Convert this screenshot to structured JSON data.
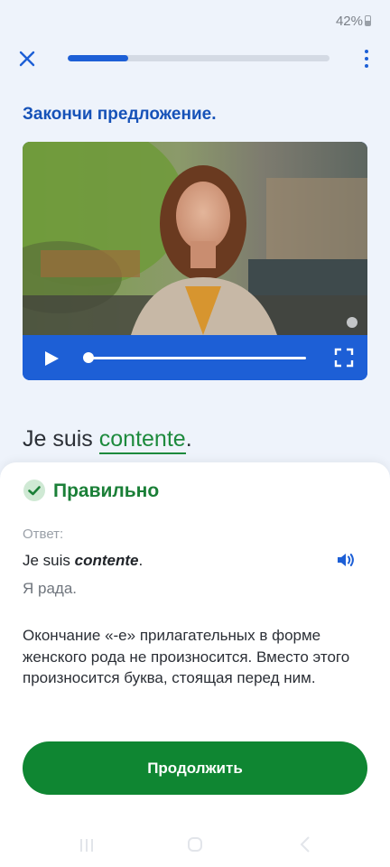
{
  "status": {
    "battery": "42%"
  },
  "lesson": {
    "progress": 0.23
  },
  "instruction": "Закончи предложение.",
  "video": {
    "playback_position": 0.0
  },
  "sentence": {
    "before": "Je suis ",
    "answer": "contente",
    "after": "."
  },
  "feedback": {
    "title": "Правильно",
    "answer_label": "Ответ:",
    "answer_prefix": "Je suis ",
    "answer_word": "contente",
    "answer_suffix": ".",
    "translation": "Я рада.",
    "explanation": "Окончание «-е» прилагательных в форме женского рода не произносится. Вместо этого произносится буква, стоящая перед ним."
  },
  "continue_label": "Продолжить",
  "colors": {
    "accent": "#1d5fd6",
    "success": "#0f8632",
    "background": "#eef3fb"
  },
  "icons": [
    "close-icon",
    "more-vert-icon",
    "play-icon",
    "fullscreen-icon",
    "check-circle-icon",
    "speaker-icon"
  ]
}
